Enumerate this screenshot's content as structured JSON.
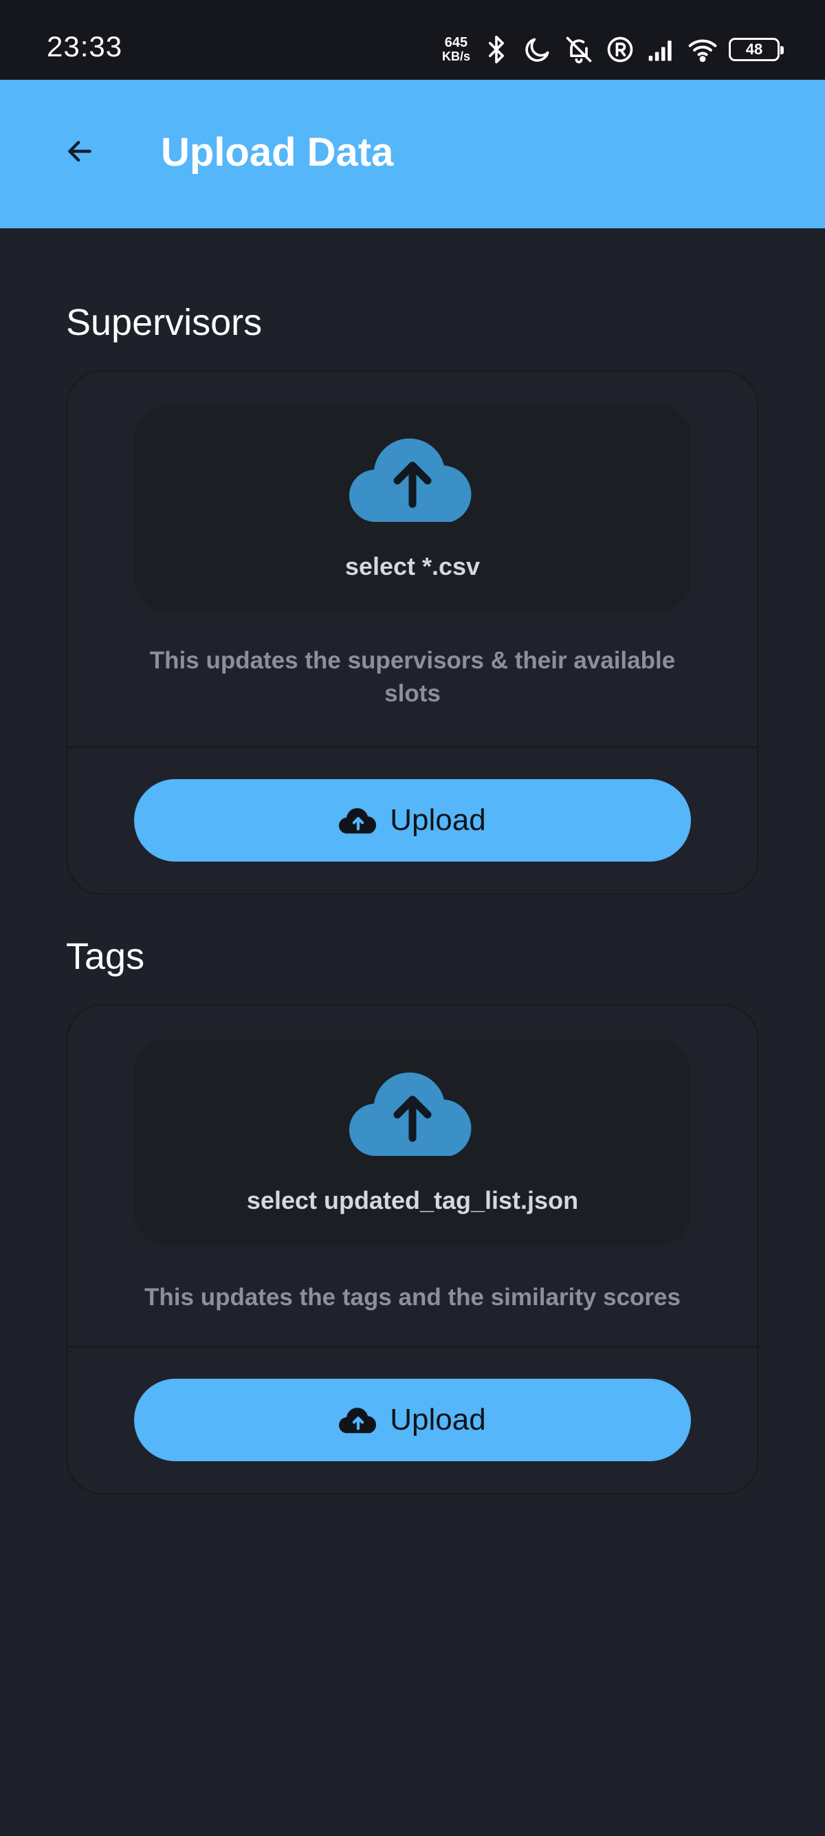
{
  "status_bar": {
    "time": "23:33",
    "net_speed_value": "645",
    "net_speed_unit": "KB/s",
    "battery": "48",
    "icons": [
      "bluetooth-icon",
      "moon-icon",
      "bell-off-icon",
      "registered-icon",
      "signal-icon",
      "wifi-icon",
      "battery-icon"
    ]
  },
  "app_bar": {
    "title": "Upload Data",
    "back_icon": "arrow-left-icon"
  },
  "sections": [
    {
      "title": "Supervisors",
      "select_label": "select *.csv",
      "description": "This updates the supervisors & their available slots",
      "upload_label": "Upload"
    },
    {
      "title": "Tags",
      "select_label": "select updated_tag_list.json",
      "description": "This updates the tags and the similarity scores",
      "upload_label": "Upload"
    }
  ],
  "colors": {
    "accent": "#55b6f9",
    "background": "#1e2129",
    "card": "#1f222b",
    "cloud_icon": "#3a90c7"
  }
}
